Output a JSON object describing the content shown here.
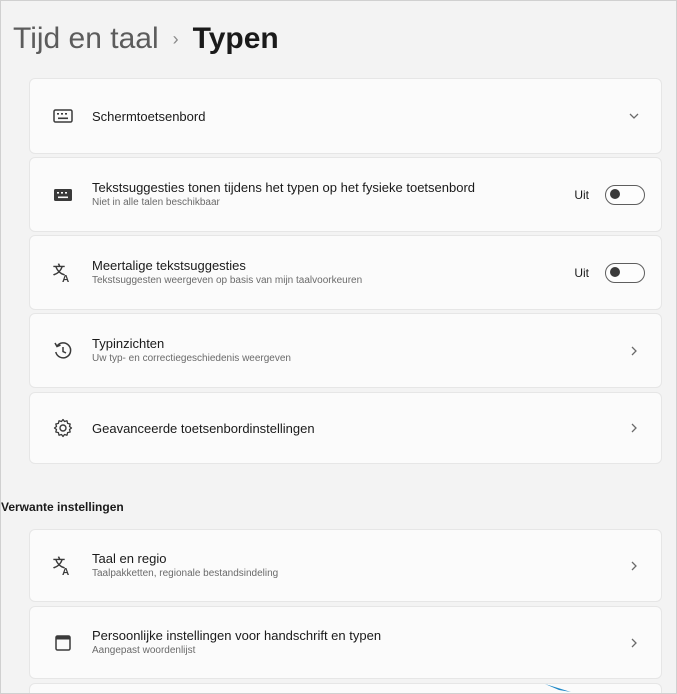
{
  "breadcrumb": {
    "parent": "Tijd en taal",
    "separator": "›",
    "current": "Typen"
  },
  "cards": [
    {
      "icon": "keyboard-icon",
      "label": "Schermtoetsenbord",
      "control": "expand"
    },
    {
      "icon": "keyboard-icon",
      "label": "Tekstsuggesties tonen tijdens het typen op het fysieke toetsenbord",
      "sub": "Niet in alle talen beschikbaar",
      "control": "toggle",
      "state": "Uit",
      "on": false
    },
    {
      "icon": "language-icon",
      "label": "Meertalige tekstsuggesties",
      "sub": "Tekstsuggesten weergeven op basis van mijn taalvoorkeuren",
      "control": "toggle",
      "state": "Uit",
      "on": false
    },
    {
      "icon": "history-icon",
      "label": "Typinzichten",
      "sub": "Uw typ- en correctiegeschiedenis weergeven",
      "control": "navigate"
    },
    {
      "icon": "gear-icon",
      "label": "Geavanceerde toetsenbordinstellingen",
      "control": "navigate"
    }
  ],
  "related": {
    "heading": "Verwante instellingen",
    "cards": [
      {
        "icon": "language-icon",
        "label": "Taal en regio",
        "sub": "Taalpakketten, regionale bestandsindeling",
        "control": "navigate"
      },
      {
        "icon": "pen-window-icon",
        "label": "Persoonlijke instellingen voor handschrift en typen",
        "sub": "Aangepast woordenlijst",
        "control": "navigate"
      }
    ]
  },
  "colors": {
    "background": "#f3f3f3",
    "card": "#fbfbfb",
    "accent_cursor": "#1e88c7"
  }
}
